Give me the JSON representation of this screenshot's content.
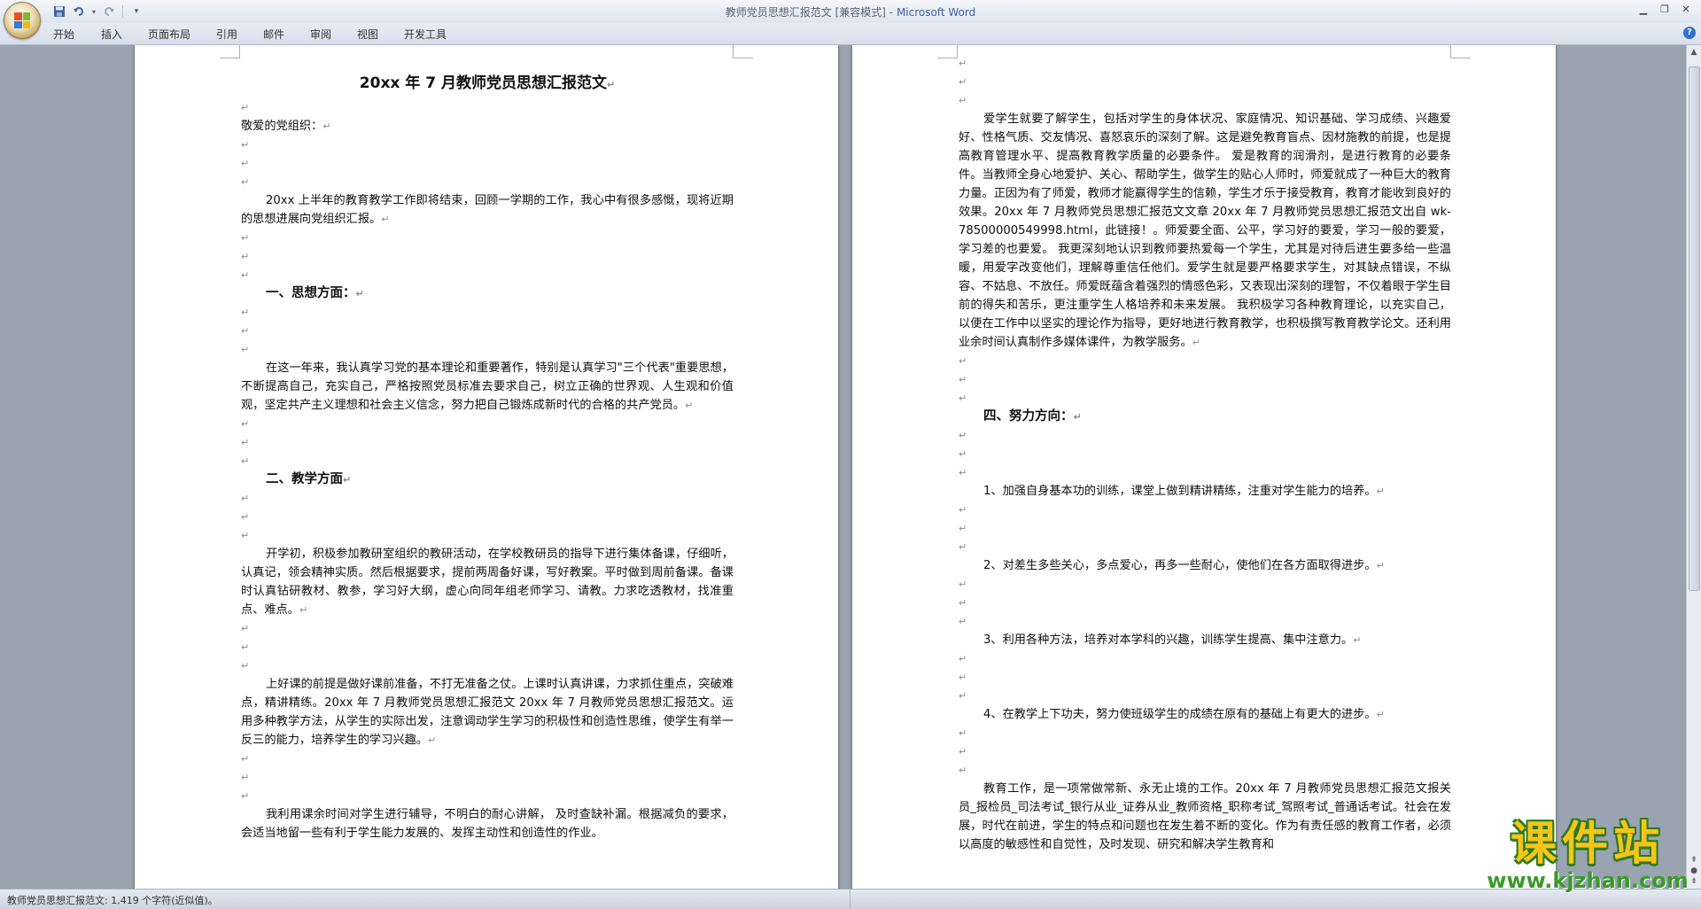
{
  "window": {
    "doc_name": "教师党员思想汇报范文",
    "mode": "[兼容模式]",
    "app_name": "Microsoft Word"
  },
  "ribbon_tabs": [
    "开始",
    "插入",
    "页面布局",
    "引用",
    "邮件",
    "审阅",
    "视图",
    "开发工具"
  ],
  "page1": {
    "title": "20xx 年 7 月教师党员思想汇报范文",
    "salutation": "敬爱的党组织：",
    "intro": "20xx 上半年的教育教学工作即将结束，回顾一学期的工作，我心中有很多感慨，现将近期的思想进展向党组织汇报。",
    "h1": "一、思想方面：",
    "p1": "在这一年来，我认真学习党的基本理论和重要著作，特别是认真学习\"三个代表\"重要思想，不断提高自己，充实自己，严格按照党员标准去要求自己，树立正确的世界观、人生观和价值观，坚定共产主义理想和社会主义信念，努力把自己锻炼成新时代的合格的共产党员。",
    "h2": "二、教学方面",
    "p2": "开学初，积极参加教研室组织的教研活动，在学校教研员的指导下进行集体备课，仔细听，认真记，领会精神实质。然后根据要求，提前两周备好课，写好教案。平时做到周前备课。备课时认真钻研教材、教参，学习好大纲，虚心向同年组老师学习、请教。力求吃透教材，找准重点、难点。",
    "p3": "上好课的前提是做好课前准备，不打无准备之仗。上课时认真讲课，力求抓住重点，突破难点，精讲精练。20xx 年 7 月教师党员思想汇报范文 20xx 年 7 月教师党员思想汇报范文。运用多种教学方法，从学生的实际出发，注意调动学生学习的积极性和创造性思维，使学生有举一反三的能力，培养学生的学习兴趣。",
    "p4": "我利用课余时间对学生进行辅导，不明白的耐心讲解， 及时查缺补漏。根据减负的要求，会适当地留一些有利于学生能力发展的、发挥主动性和创造性的作业。"
  },
  "page2": {
    "p1": "爱学生就要了解学生，包括对学生的身体状况、家庭情况、知识基础、学习成绩、兴趣爱好、性格气质、交友情况、喜怒哀乐的深刻了解。这是避免教育盲点、因材施教的前提，也是提高教育管理水平、提高教育教学质量的必要条件。 爱是教育的润滑剂，是进行教育的必要条件。当教师全身心地爱护、关心、帮助学生，做学生的贴心人师时，师爱就成了一种巨大的教育力量。正因为有了师爱，教师才能赢得学生的信赖，学生才乐于接受教育，教育才能收到良好的效果。20xx 年 7 月教师党员思想汇报范文文章 20xx 年 7 月教师党员思想汇报范文出自 wk-78500000549998.html，此链接！。师爱要全面、公平，学习好的要爱，学习一般的要爱，学习差的也要爱。 我更深刻地认识到教师要热爱每一个学生，尤其是对待后进生要多给一些温暖，用爱字改变他们，理解尊重信任他们。爱学生就是要严格要求学生，对其缺点错误，不纵容、不姑息、不放任。师爱既蕴含着强烈的情感色彩，又表现出深刻的理智，不仅着眼于学生目前的得失和苦乐，更注重学生人格培养和未来发展。 我积极学习各种教育理论，以充实自己，以便在工作中以坚实的理论作为指导，更好地进行教育教学，也积极撰写教育教学论文。还利用业余时间认真制作多媒体课件，为教学服务。",
    "h4": "四、努力方向：",
    "item1": "1、加强自身基本功的训练，课堂上做到精讲精练，注重对学生能力的培养。",
    "item2": "2、对差生多些关心，多点爱心，再多一些耐心，使他们在各方面取得进步。",
    "item3": "3、利用各种方法，培养对本学科的兴趣，训练学生提高、集中注意力。",
    "item4": "4、在教学上下功夫，努力使班级学生的成绩在原有的基础上有更大的进步。",
    "p_last": "教育工作，是一项常做常新、永无止境的工作。20xx 年 7 月教师党员思想汇报范文报关员_报检员_司法考试_银行从业_证券从业_教师资格_职称考试_驾照考试_普通话考试。社会在发展，时代在前进，学生的特点和问题也在发生着不断的变化。作为有责任感的教育工作者，必须以高度的敏感性和自觉性，及时发现、研究和解决学生教育和"
  },
  "status": {
    "text": "教师党员思想汇报范文: 1,419 个字符(近似值)。"
  },
  "watermark": {
    "cn": "课件站",
    "url": "www.kjzhan.com"
  }
}
